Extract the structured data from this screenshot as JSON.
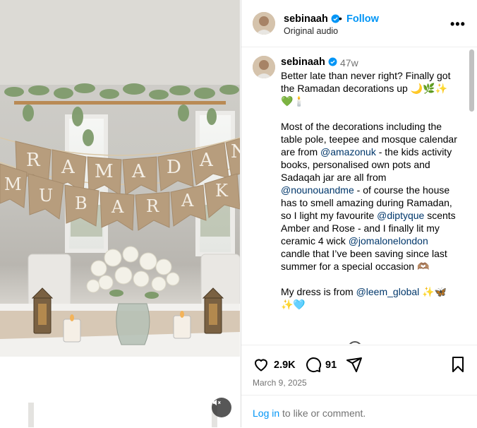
{
  "post": {
    "username": "sebinaah",
    "follow_label": "Follow",
    "audio_label": "Original audio",
    "more_label": "•••",
    "time_ago": "47w",
    "caption_parts": [
      {
        "t": "Better late than never right? Finally got the Ramadan decorations up 🌙🌿✨💚🕯️\n\nMost of the decorations including the table pole, teepee and mosque calendar are from "
      },
      {
        "m": "@amazonuk"
      },
      {
        "t": " - the kids activity books, personalised own pots and Sadaqah jar are all from "
      },
      {
        "m": "@nounouandme"
      },
      {
        "t": " - of course the house has to smell amazing during Ramadan, so I light my favourite "
      },
      {
        "m": "@diptyque"
      },
      {
        "t": " scents Amber and Rose - and I finally lit my ceramic 4 wick "
      },
      {
        "m": "@jomalonelondon"
      },
      {
        "t": " candle that I’ve been saving since last summer for a special occasion 🫶🏽\n\nMy dress is from "
      },
      {
        "m": "@leem_global"
      },
      {
        "t": " ✨🦋✨🩵"
      }
    ],
    "likes": "2.9K",
    "comments": "91",
    "date": "March 9, 2025",
    "login_link": "Log in",
    "login_rest": " to like or comment."
  },
  "banner": {
    "top_letters": [
      "R",
      "A",
      "M",
      "A",
      "D",
      "A",
      "N"
    ],
    "bottom_letters": [
      "M",
      "U",
      "B",
      "A",
      "R",
      "A",
      "K"
    ]
  },
  "colors": {
    "accent": "#0095f6",
    "verified": "#0095f6",
    "mention": "#00376b",
    "burlap": "#b79d7d"
  },
  "icons": [
    "heart-icon",
    "comment-icon",
    "share-icon",
    "bookmark-icon",
    "muted-speaker-icon",
    "verified-badge-icon"
  ]
}
